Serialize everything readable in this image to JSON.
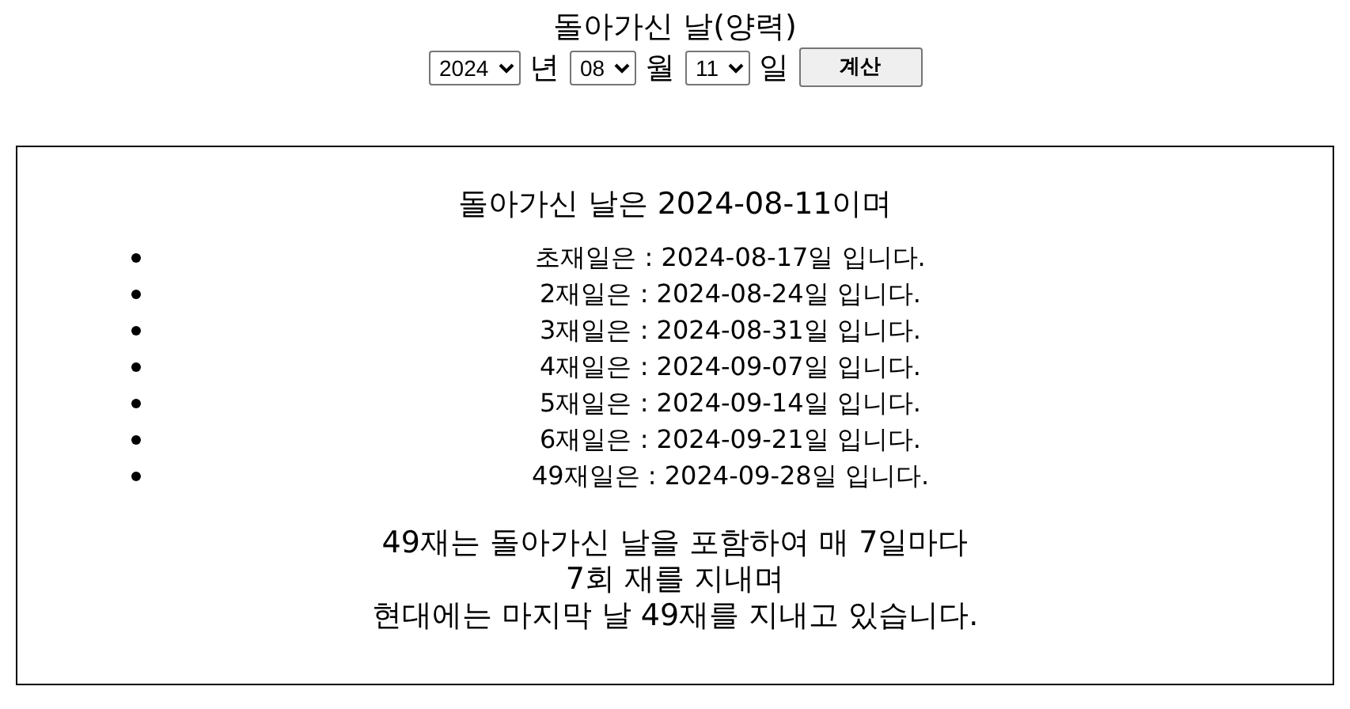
{
  "form": {
    "title": "돌아가신 날(양력)",
    "fields": [
      {
        "value": "2024",
        "unit": "년"
      },
      {
        "value": "08",
        "unit": "월"
      },
      {
        "value": "11",
        "unit": "일"
      }
    ],
    "button": "계산"
  },
  "result": {
    "heading": "돌아가신 날은 2024-08-11이며",
    "items": [
      "초재일은 : 2024-08-17일 입니다.",
      "2재일은 : 2024-08-24일 입니다.",
      "3재일은 : 2024-08-31일 입니다.",
      "4재일은 : 2024-09-07일 입니다.",
      "5재일은 : 2024-09-14일 입니다.",
      "6재일은 : 2024-09-21일 입니다.",
      "49재일은 : 2024-09-28일 입니다."
    ],
    "note": [
      "49재는 돌아가신 날을 포함하여 매 7일마다",
      "7회 재를 지내며",
      "현대에는 마지막 날 49재를 지내고 있습니다."
    ]
  }
}
